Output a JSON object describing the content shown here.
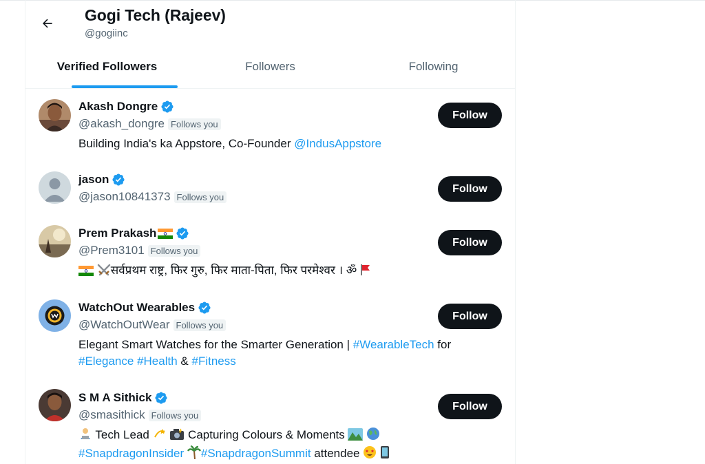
{
  "header": {
    "back_label": "Back",
    "title": "Gogi Tech (Rajeev)",
    "handle": "@gogiinc"
  },
  "tabs": [
    {
      "label": "Verified Followers",
      "active": true
    },
    {
      "label": "Followers",
      "active": false
    },
    {
      "label": "Following",
      "active": false
    }
  ],
  "users": [
    {
      "name": "Akash Dongre",
      "handle": "@akash_dongre",
      "badge": "Follows you",
      "button": "Follow",
      "bio": [
        "Building India's ka Appstore, Co-Founder ",
        "@IndusAppstore"
      ]
    },
    {
      "name": "jason",
      "handle": "@jason10841373",
      "badge": "Follows you",
      "button": "Follow"
    },
    {
      "name": "Prem Prakash",
      "handle": "@Prem3101",
      "badge": "Follows you",
      "button": "Follow",
      "bio": [
        "सर्वप्रथम राष्ट्र, फिर गुरु, फिर माता-पिता, फिर परमेश्वर । ॐ"
      ]
    },
    {
      "name": "WatchOut Wearables",
      "handle": "@WatchOutWear",
      "badge": "Follows you",
      "button": "Follow",
      "bio": [
        "Elegant Smart Watches for the Smarter Generation | ",
        "#WearableTech",
        " for",
        "#Elegance",
        " ",
        "#Health",
        " & ",
        "#Fitness"
      ]
    },
    {
      "name": "S M A Sithick",
      "handle": "@smasithick",
      "badge": "Follows you",
      "button": "Follow",
      "bio": [
        " Tech Lead ",
        " Capturing Colours & Moments ",
        "#SnapdragonInsider",
        "#SnapdragonSummit",
        " attendee "
      ]
    }
  ],
  "colors": {
    "accent": "#1d9bf0",
    "button_bg": "#0f1419",
    "secondary_text": "#536471"
  }
}
